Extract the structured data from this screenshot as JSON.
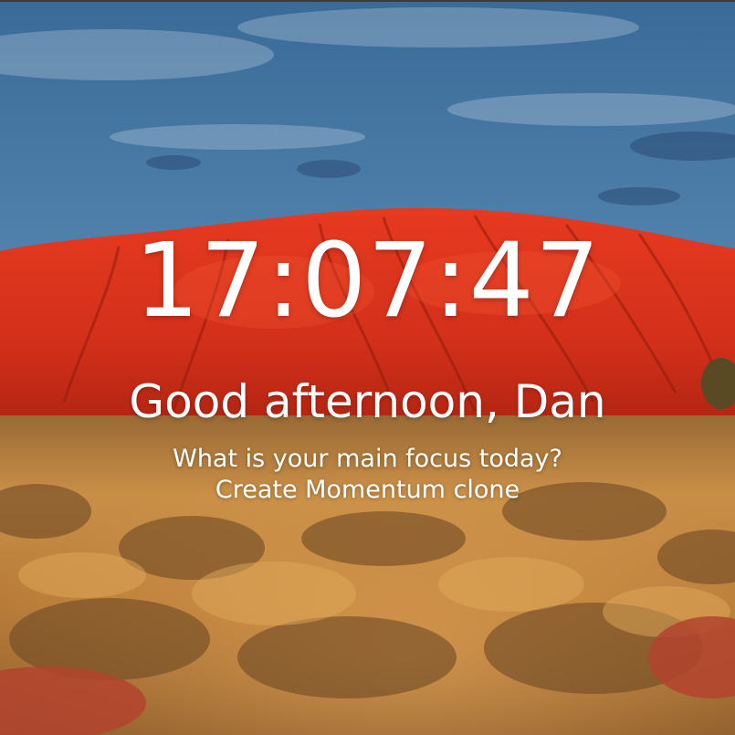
{
  "clock": {
    "time": "17:07:47"
  },
  "greeting": {
    "text": "Good afternoon, Dan"
  },
  "focus": {
    "question": "What is your main focus today?",
    "value": "Create Momentum clone"
  },
  "colors": {
    "text": "#ffffff",
    "sky_top": "#3f6f9b",
    "sky_bottom": "#7aa7c6",
    "rock": "#d6321d",
    "grass": "#c98d3c",
    "ground": "#b2442f"
  }
}
